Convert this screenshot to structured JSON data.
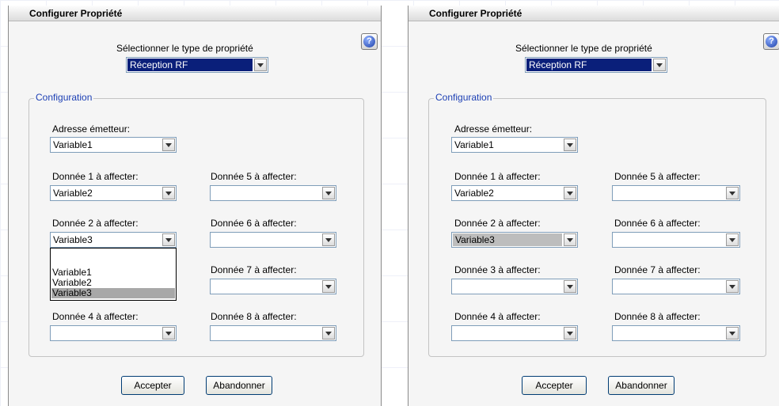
{
  "title": "Configurer Propriété",
  "help_symbol": "?",
  "type_label": "Sélectionner le type de propriété",
  "type_value": "Réception RF",
  "config_legend": "Configuration",
  "labels": {
    "adresse": "Adresse émetteur:",
    "d1": "Donnée 1 à affecter:",
    "d2": "Donnée 2 à affecter:",
    "d3": "Donnée 3 à affecter:",
    "d4": "Donnée 4 à affecter:",
    "d5": "Donnée 5 à affecter:",
    "d6": "Donnée 6 à affecter:",
    "d7": "Donnée 7 à affecter:",
    "d8": "Donnée 8 à affecter:"
  },
  "values": {
    "adresse": "Variable1",
    "d1": "Variable2",
    "d2": "Variable3"
  },
  "dropdown_options": [
    "Variable1",
    "Variable2",
    "Variable3"
  ],
  "buttons": {
    "accept": "Accepter",
    "cancel": "Abandonner"
  },
  "colors": {
    "selection_blue": "#0a1f7a",
    "legend_blue": "#1c3fb4",
    "option_highlight": "#a8a8a8"
  }
}
